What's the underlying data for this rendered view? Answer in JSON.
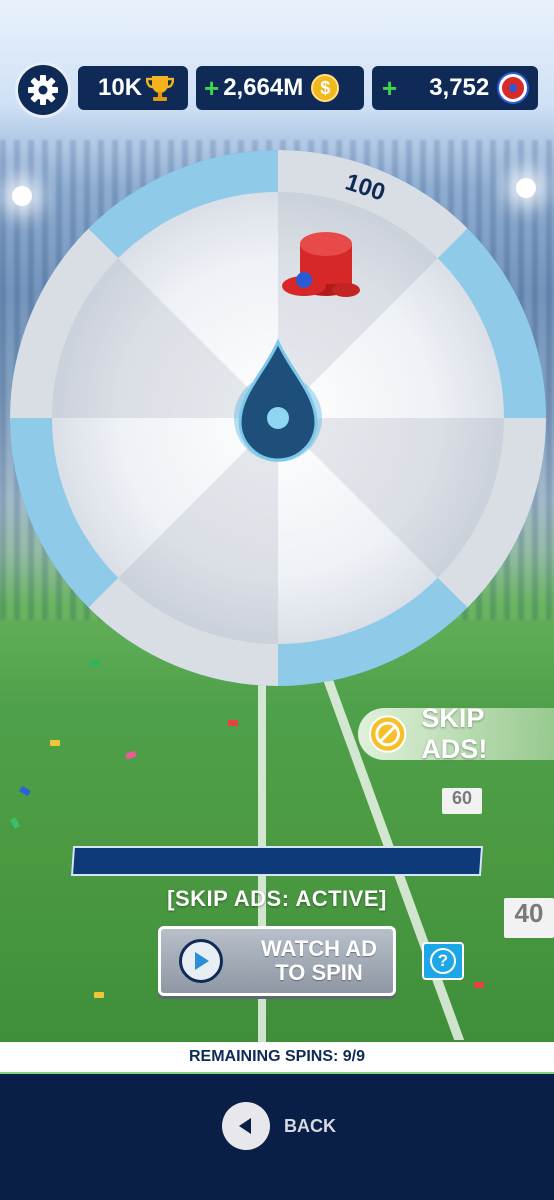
{
  "top_bar": {
    "trophies": "10K",
    "coins_plus": "+",
    "coins": "2,664M",
    "coin_symbol": "$",
    "tokens_plus": "+",
    "tokens": "3,752"
  },
  "wheel": {
    "segments": 8,
    "reward_label": "100"
  },
  "skip_badge": {
    "label": "SKIP ADS!"
  },
  "status_text": "[SKIP ADS: ACTIVE]",
  "watch_button": {
    "line1": "WATCH AD",
    "line2": "TO SPIN"
  },
  "help_button": {
    "label": "?"
  },
  "remaining_spins": "REMAINING SPINS: 9/9",
  "back": {
    "label": "BACK"
  },
  "yard_markers": [
    "60",
    "40"
  ],
  "colors": {
    "navy": "#0f2a57",
    "accent_blue": "#3aa7dc",
    "green_plus": "#3ed64a"
  }
}
